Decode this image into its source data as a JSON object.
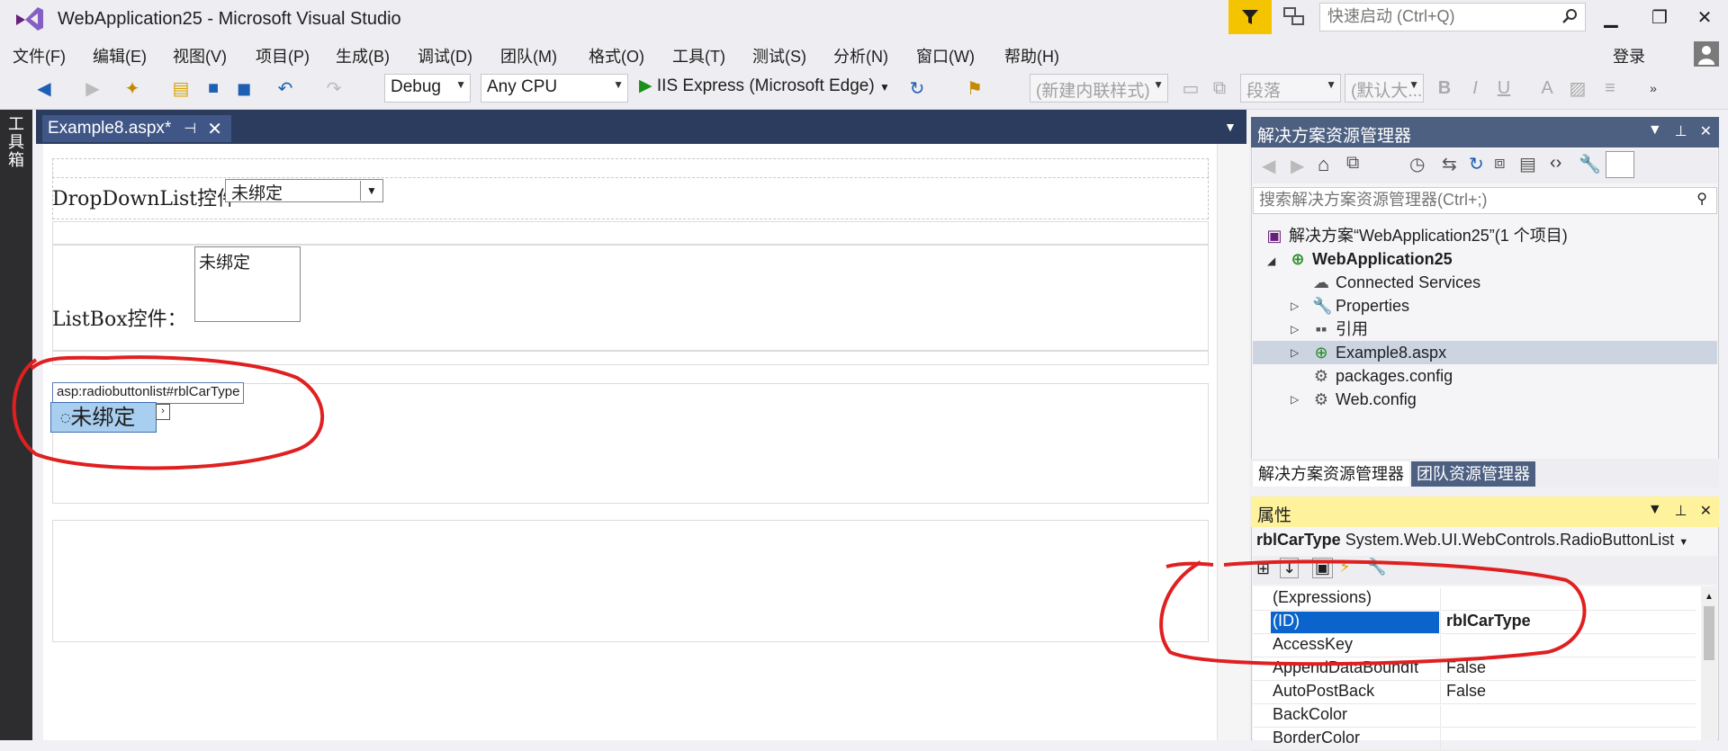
{
  "window": {
    "title": "WebApplication25 - Microsoft Visual Studio",
    "quick_launch_placeholder": "快速启动 (Ctrl+Q)",
    "login": "登录"
  },
  "menu": [
    "文件(F)",
    "编辑(E)",
    "视图(V)",
    "项目(P)",
    "生成(B)",
    "调试(D)",
    "团队(M)",
    "格式(O)",
    "工具(T)",
    "测试(S)",
    "分析(N)",
    "窗口(W)",
    "帮助(H)"
  ],
  "toolbar": {
    "config": "Debug",
    "platform": "Any CPU",
    "run_target": "IIS Express (Microsoft Edge)",
    "style_combo": "(新建内联样式)",
    "block_combo": "段落",
    "font_combo": "(默认大...",
    "bold": "B",
    "italic": "I",
    "underline": "U"
  },
  "toolbox_tab": "工具箱",
  "document": {
    "tab_title": "Example8.aspx*",
    "ddl_label": "DropDownList控件",
    "ddl_value": "未绑定",
    "listbox_label": "ListBox控件：",
    "listbox_value": "未绑定",
    "rbl_tag": "asp:radiobuttonlist#rblCarType",
    "rbl_value": "未绑定"
  },
  "solution_explorer": {
    "title": "解决方案资源管理器",
    "search_placeholder": "搜索解决方案资源管理器(Ctrl+;)",
    "tree": [
      {
        "label": "解决方案“WebApplication25”(1 个项目)",
        "icon": "solution-icon"
      },
      {
        "label": "WebApplication25",
        "icon": "web-project-icon"
      },
      {
        "label": "Connected Services",
        "icon": "cloud-icon"
      },
      {
        "label": "Properties",
        "icon": "wrench-icon"
      },
      {
        "label": "引用",
        "icon": "references-icon"
      },
      {
        "label": "Example8.aspx",
        "icon": "aspx-file-icon"
      },
      {
        "label": "packages.config",
        "icon": "config-file-icon"
      },
      {
        "label": "Web.config",
        "icon": "config-file-icon"
      }
    ],
    "tabs": [
      "解决方案资源管理器",
      "团队资源管理器"
    ]
  },
  "properties": {
    "title": "属性",
    "object_name": "rblCarType",
    "object_type": "System.Web.UI.WebControls.RadioButtonList",
    "rows": [
      {
        "name": "(Expressions)",
        "value": ""
      },
      {
        "name": "(ID)",
        "value": "rblCarType"
      },
      {
        "name": "AccessKey",
        "value": ""
      },
      {
        "name": "AppendDataBoundIt",
        "value": "False"
      },
      {
        "name": "AutoPostBack",
        "value": "False"
      },
      {
        "name": "BackColor",
        "value": ""
      },
      {
        "name": "BorderColor",
        "value": ""
      }
    ]
  },
  "colors": {
    "accent": "#0a64cc",
    "annotation": "#e02020",
    "panel_header": "#4d6082",
    "doc_tabbar": "#2b3c5e"
  }
}
